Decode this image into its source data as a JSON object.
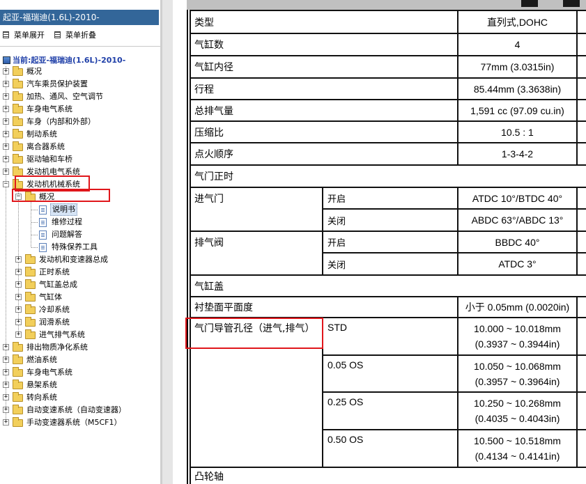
{
  "left": {
    "title": "起亚-福瑞迪(1.6L)-2010-",
    "expand_label": "菜单展开",
    "collapse_label": "菜单折叠",
    "current": "当前:起亚-福瑞迪(1.6L)-2010-",
    "tree": [
      "概况",
      "汽车乘员保护装置",
      "加热、通风、空气调节",
      "车身电气系统",
      "车身（内部和外部）",
      "制动系统",
      "离合器系统",
      "驱动轴和车桥",
      "发动机电气系统",
      "发动机机械系统",
      "概况",
      "说明书",
      "维修过程",
      "问题解答",
      "特殊保养工具",
      "发动机和变速器总成",
      "正时系统",
      "气缸盖总成",
      "气缸体",
      "冷却系统",
      "润滑系统",
      "进气排气系统",
      "排出物质净化系统",
      "燃油系统",
      "车身电气系统",
      "悬架系统",
      "转向系统",
      "自动变速系统（自动变速器）",
      "手动变速器系统（M5CF1）"
    ]
  },
  "spec": {
    "type_label": "类型",
    "type_value": "直列式,DOHC",
    "cyl_label": "气缸数",
    "cyl_value": "4",
    "bore_label": "气缸内径",
    "bore_value": "77mm (3.0315in)",
    "stroke_label": "行程",
    "stroke_value": "85.44mm (3.3638in)",
    "disp_label": "总排气量",
    "disp_value": "1,591 cc (97.09 cu.in)",
    "comp_label": "压缩比",
    "comp_value": "10.5 : 1",
    "fire_label": "点火顺序",
    "fire_value": "1-3-4-2",
    "valve_timing": "气门正时",
    "intake_label": "进气门",
    "open_label": "开启",
    "close_label": "关闭",
    "intake_open": "ATDC 10°/BTDC 40°",
    "intake_close": "ABDC 63°/ABDC 13°",
    "exhaust_label": "排气阀",
    "open_label2": "开启",
    "close_label2": "关闭",
    "exhaust_open": "BBDC 40°",
    "exhaust_close": "ATDC 3°",
    "cyl_head": "气缸盖",
    "flatness_label": "衬垫面平面度",
    "flatness_value": "小于 0.05mm (0.0020in)",
    "guide_label": "气门导管孔径（进气,排气）",
    "guide_rows": [
      {
        "size": "STD",
        "mm": "10.000 ~ 10.018mm",
        "in": "(0.3937 ~ 0.3944in)"
      },
      {
        "size": "0.05 OS",
        "mm": "10.050 ~ 10.068mm",
        "in": "(0.3957 ~ 0.3964in)"
      },
      {
        "size": "0.25 OS",
        "mm": "10.250 ~ 10.268mm",
        "in": "(0.4035 ~ 0.4043in)"
      },
      {
        "size": "0.50 OS",
        "mm": "10.500 ~ 10.518mm",
        "in": "(0.4134 ~ 0.4141in)"
      }
    ],
    "camshaft": "凸轮轴"
  },
  "colors": {
    "highlight_box": "#e0161b",
    "title_bar": "#336699",
    "current_text": "#1f3fa8"
  }
}
